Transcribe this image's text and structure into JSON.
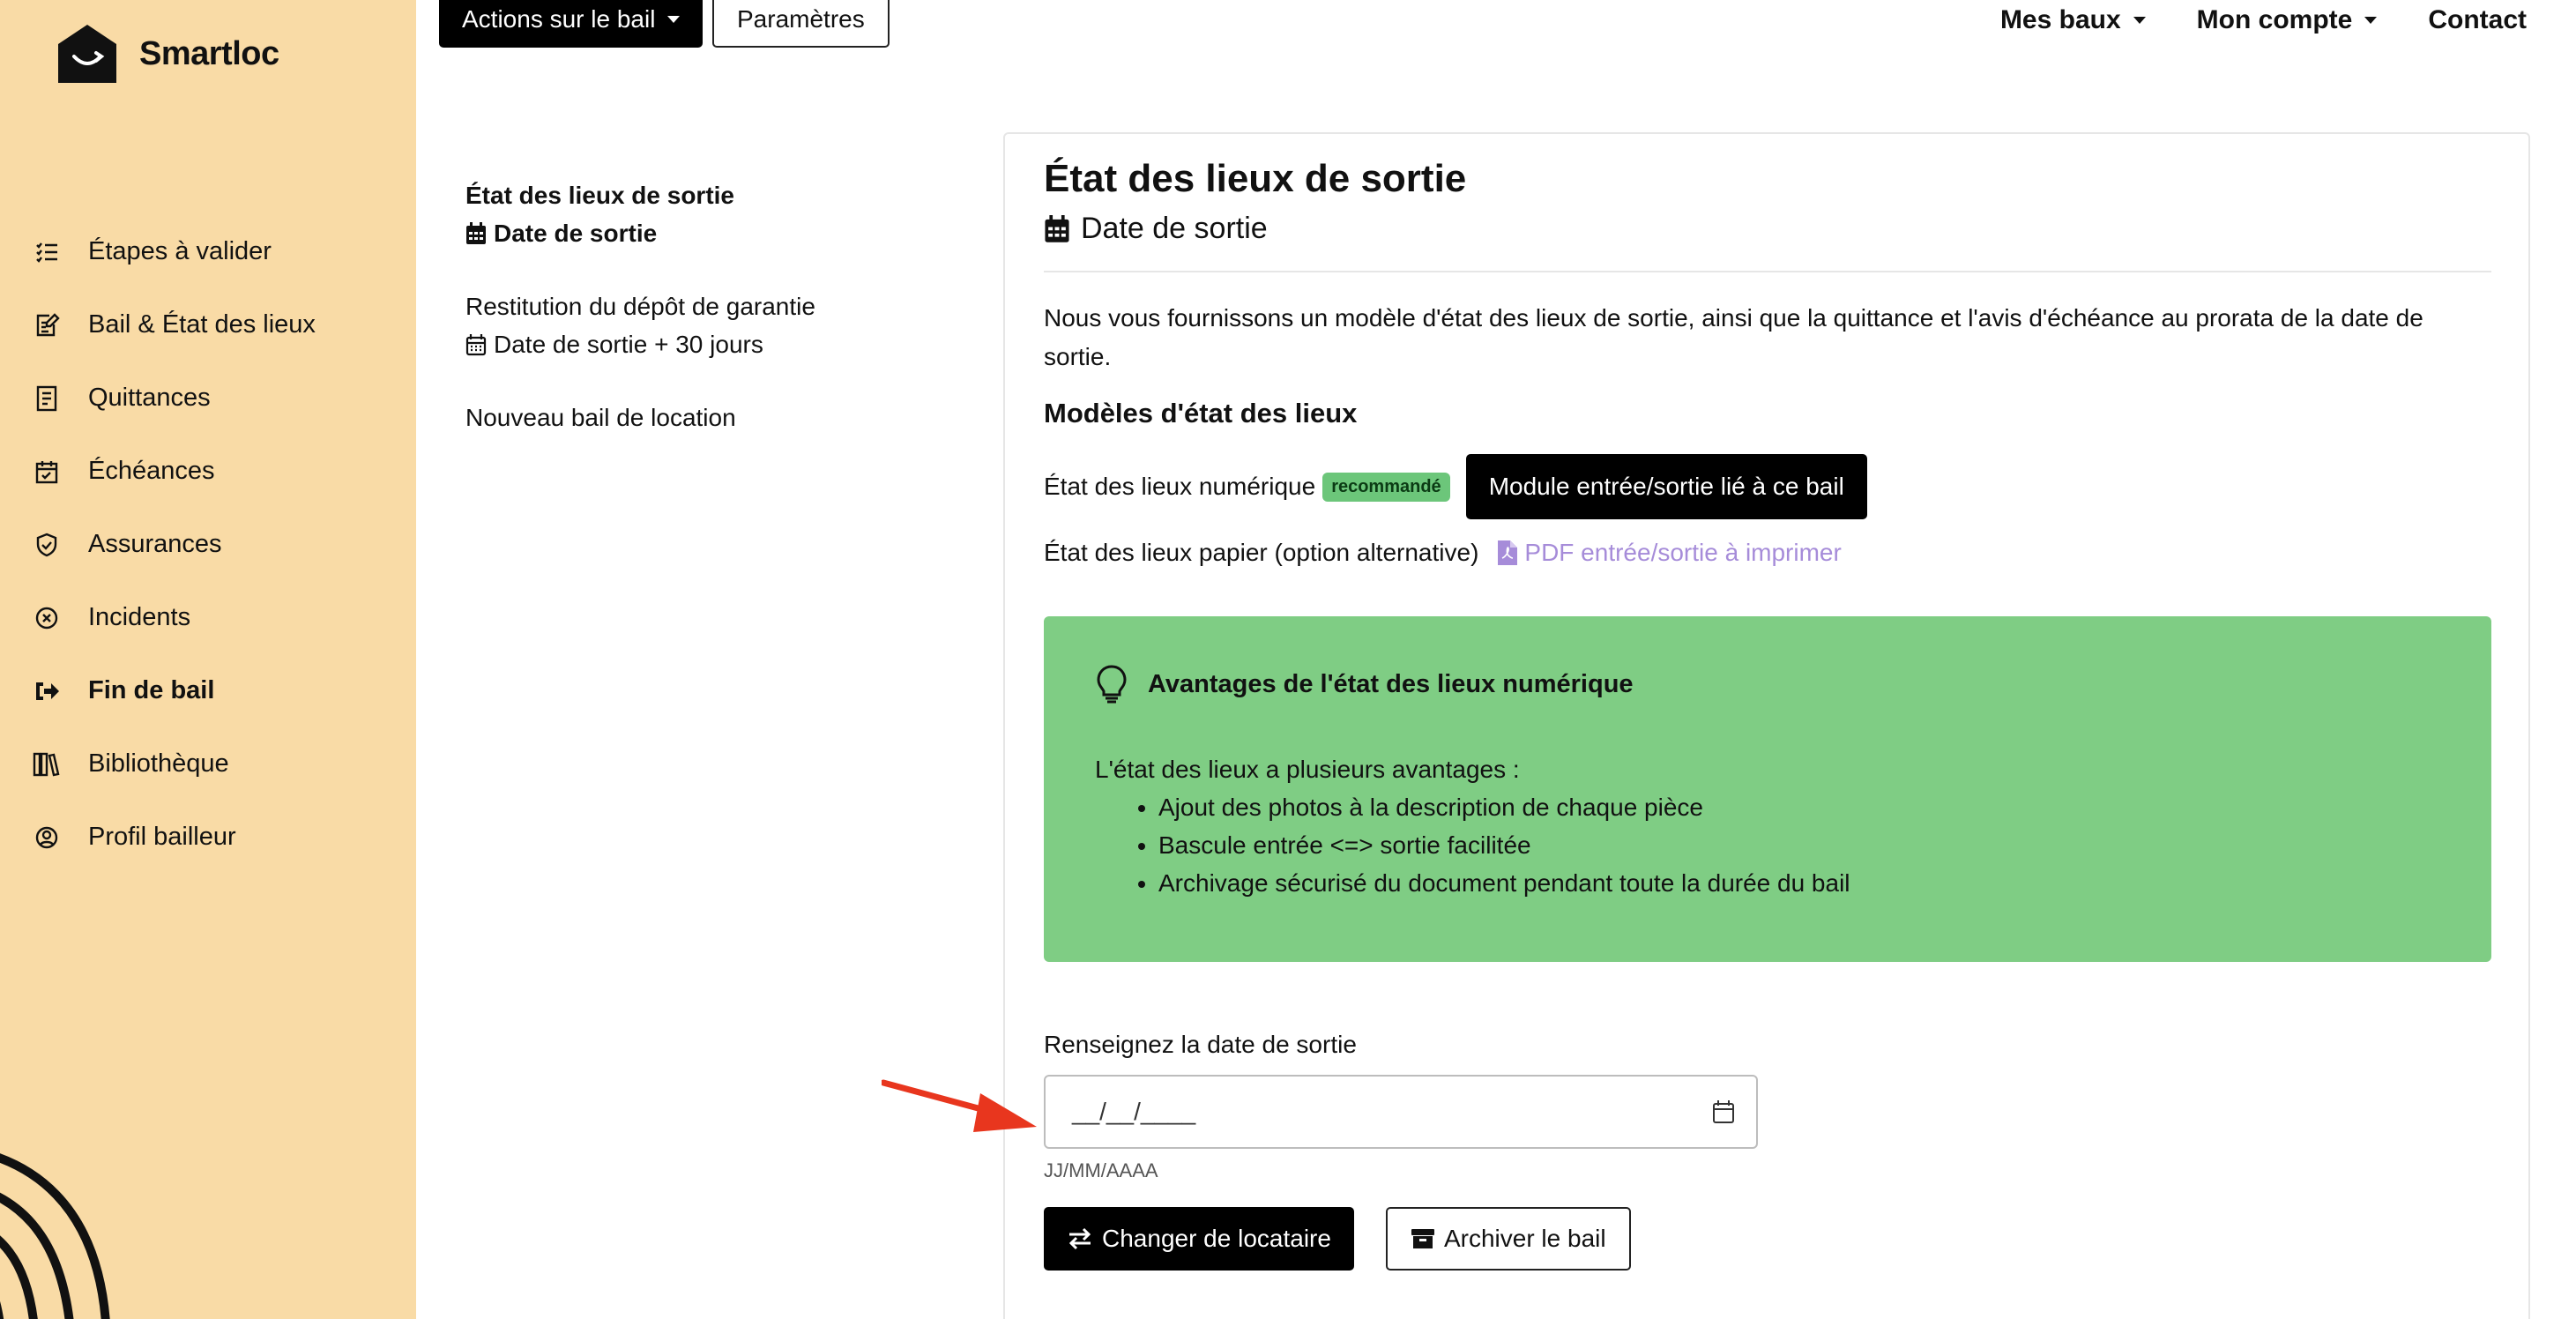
{
  "brand": {
    "name": "Smartloc"
  },
  "sidebar": {
    "items": [
      {
        "label": "Étapes à valider",
        "icon": "checklist-icon",
        "active": false
      },
      {
        "label": "Bail & État des lieux",
        "icon": "edit-document-icon",
        "active": false
      },
      {
        "label": "Quittances",
        "icon": "receipt-icon",
        "active": false
      },
      {
        "label": "Échéances",
        "icon": "calendar-check-icon",
        "active": false
      },
      {
        "label": "Assurances",
        "icon": "shield-check-icon",
        "active": false
      },
      {
        "label": "Incidents",
        "icon": "circle-x-icon",
        "active": false
      },
      {
        "label": "Fin de bail",
        "icon": "sign-out-icon",
        "active": true
      },
      {
        "label": "Bibliothèque",
        "icon": "library-icon",
        "active": false
      },
      {
        "label": "Profil bailleur",
        "icon": "user-circle-icon",
        "active": false
      }
    ]
  },
  "topbar": {
    "actions_label": "Actions sur le bail",
    "params_label": "Paramètres",
    "nav": {
      "mes_baux": "Mes baux",
      "mon_compte": "Mon compte",
      "contact": "Contact"
    }
  },
  "steps": [
    {
      "title": "État des lieux de sortie",
      "sub": "Date de sortie",
      "active": true
    },
    {
      "title": "Restitution du dépôt de garantie",
      "sub": "Date de sortie + 30 jours",
      "active": false
    },
    {
      "title": "Nouveau bail de location",
      "sub": "",
      "active": false
    }
  ],
  "card": {
    "title": "État des lieux de sortie",
    "subtitle": "Date de sortie",
    "intro": "Nous vous fournissons un modèle d'état des lieux de sortie, ainsi que la quittance et l'avis d'échéance au prorata de la date de sortie.",
    "models_heading": "Modèles d'état des lieux",
    "numeric_label": "État des lieux numérique",
    "badge": "recommandé",
    "module_button": "Module entrée/sortie lié à ce bail",
    "paper_label": "État des lieux papier (option alternative)",
    "pdf_link": "PDF entrée/sortie à imprimer",
    "advantages": {
      "heading": "Avantages de l'état des lieux numérique",
      "text": "L'état des lieux a plusieurs avantages :",
      "items": [
        "Ajout des photos à la description de chaque pièce",
        "Bascule entrée <=> sortie facilitée",
        "Archivage sécurisé du document pendant toute la durée du bail"
      ]
    },
    "date_label": "Renseignez la date de sortie",
    "date_placeholder": "__/__/____",
    "date_hint": "JJ/MM/AAAA",
    "change_tenant_button": "Changer de locataire",
    "archive_button": "Archiver le bail"
  },
  "colors": {
    "sidebar_bg": "#f9dba6",
    "advantages_bg": "#7fcd84",
    "badge_bg": "#6cc67a",
    "link": "#a68cd9",
    "arrow": "#e8361e"
  }
}
